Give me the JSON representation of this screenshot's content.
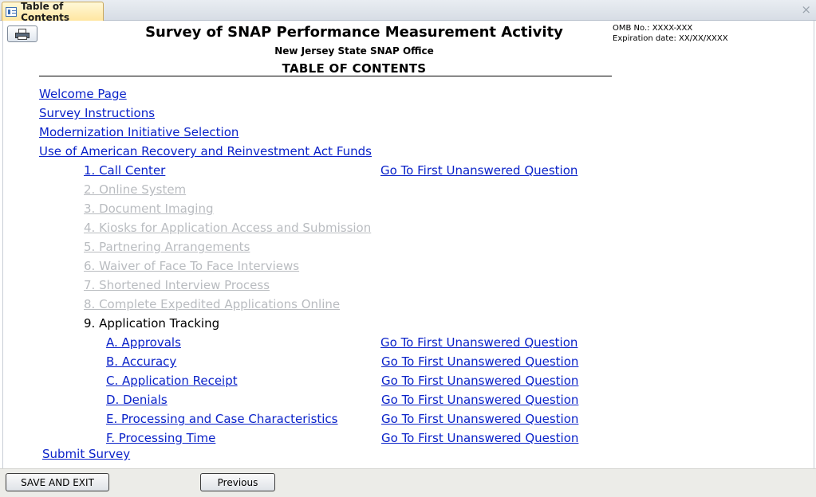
{
  "tab": {
    "label": "Table of Contents",
    "close": "×"
  },
  "header": {
    "title": "Survey of SNAP Performance Measurement Activity",
    "subtitle": "New Jersey State SNAP Office",
    "toc_heading": "TABLE OF CONTENTS",
    "omb_label": "OMB No.:  XXXX-XXX",
    "expiration_label": "Expiration date:  XX/XX/XXXX"
  },
  "links": {
    "welcome": "Welcome Page",
    "instructions": "Survey Instructions",
    "modernization": "Modernization Initiative Selection",
    "arra": "Use of American Recovery and Reinvestment Act Funds",
    "submit": "Submit Survey"
  },
  "initiatives": [
    {
      "label": "1. Call Center",
      "state": "enabled"
    },
    {
      "label": "2. Online System",
      "state": "disabled"
    },
    {
      "label": "3. Document Imaging",
      "state": "disabled"
    },
    {
      "label": "4. Kiosks for Application Access and Submission",
      "state": "disabled"
    },
    {
      "label": "5. Partnering Arrangements",
      "state": "disabled"
    },
    {
      "label": "6. Waiver of Face To Face Interviews",
      "state": "disabled"
    },
    {
      "label": "7. Shortened Interview Process",
      "state": "disabled"
    },
    {
      "label": "8. Complete Expedited Applications Online",
      "state": "disabled"
    },
    {
      "label": "9. Application Tracking",
      "state": "plain"
    }
  ],
  "subitems": [
    {
      "label": "A. Approvals"
    },
    {
      "label": "B. Accuracy"
    },
    {
      "label": "C. Application Receipt"
    },
    {
      "label": "D. Denials"
    },
    {
      "label": "E. Processing and Case Characteristics"
    },
    {
      "label": "F. Processing Time"
    }
  ],
  "goto_label": "Go To First Unanswered Question",
  "footer": {
    "save_exit": "SAVE AND EXIT",
    "previous": "Previous"
  }
}
